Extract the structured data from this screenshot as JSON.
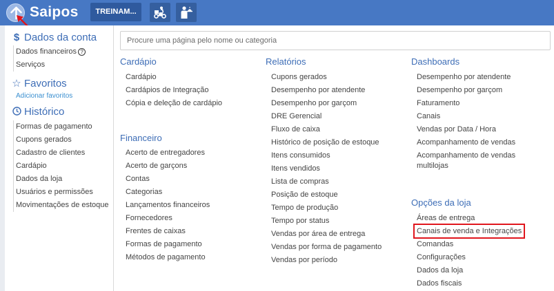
{
  "topbar": {
    "brand": "Saipos",
    "store_label": "TREINAM...",
    "icons": [
      "arrow-up-icon",
      "delivery-icon",
      "waiter-icon"
    ],
    "colors": {
      "bar": "#4778c4",
      "accent": "#3d6db6",
      "annotation": "#e0151c"
    }
  },
  "sidebar": {
    "account": {
      "title": "Dados da conta",
      "icon": "dollar-icon",
      "items": [
        "Dados financeiros",
        "Serviços"
      ],
      "help_glyph": "?"
    },
    "favorites": {
      "title": "Favoritos",
      "icon": "star-icon",
      "add_label": "Adicionar favoritos"
    },
    "history": {
      "title": "Histórico",
      "icon": "clock-icon",
      "items": [
        "Formas de pagamento",
        "Cupons gerados",
        "Cadastro de clientes",
        "Cardápio",
        "Dados da loja",
        "Usuários e permissões",
        "Movimentações de estoque"
      ]
    }
  },
  "search": {
    "placeholder": "Procure uma página pelo nome ou categoria"
  },
  "sections": {
    "cardapio": {
      "title": "Cardápio",
      "items": [
        "Cardápio",
        "Cardápios de Integração",
        "Cópia e deleção de cardápio"
      ]
    },
    "financeiro": {
      "title": "Financeiro",
      "items": [
        "Acerto de entregadores",
        "Acerto de garçons",
        "Contas",
        "Categorias",
        "Lançamentos financeiros",
        "Fornecedores",
        "Frentes de caixas",
        "Formas de pagamento",
        "Métodos de pagamento"
      ]
    },
    "relatorios": {
      "title": "Relatórios",
      "items": [
        "Cupons gerados",
        "Desempenho por atendente",
        "Desempenho por garçom",
        "DRE Gerencial",
        "Fluxo de caixa",
        "Histórico de posição de estoque",
        "Itens consumidos",
        "Itens vendidos",
        "Lista de compras",
        "Posição de estoque",
        "Tempo de produção",
        "Tempo por status",
        "Vendas por área de entrega",
        "Vendas por forma de pagamento",
        "Vendas por período"
      ]
    },
    "dashboards": {
      "title": "Dashboards",
      "items": [
        "Desempenho por atendente",
        "Desempenho por garçom",
        "Faturamento",
        "Canais",
        "Vendas por Data / Hora",
        "Acompanhamento de vendas",
        "Acompanhamento de vendas multilojas"
      ]
    },
    "opcoes": {
      "title": "Opções da loja",
      "items": [
        "Áreas de entrega",
        "Canais de venda e Integrações",
        "Comandas",
        "Configurações",
        "Dados da loja",
        "Dados fiscais"
      ]
    }
  }
}
